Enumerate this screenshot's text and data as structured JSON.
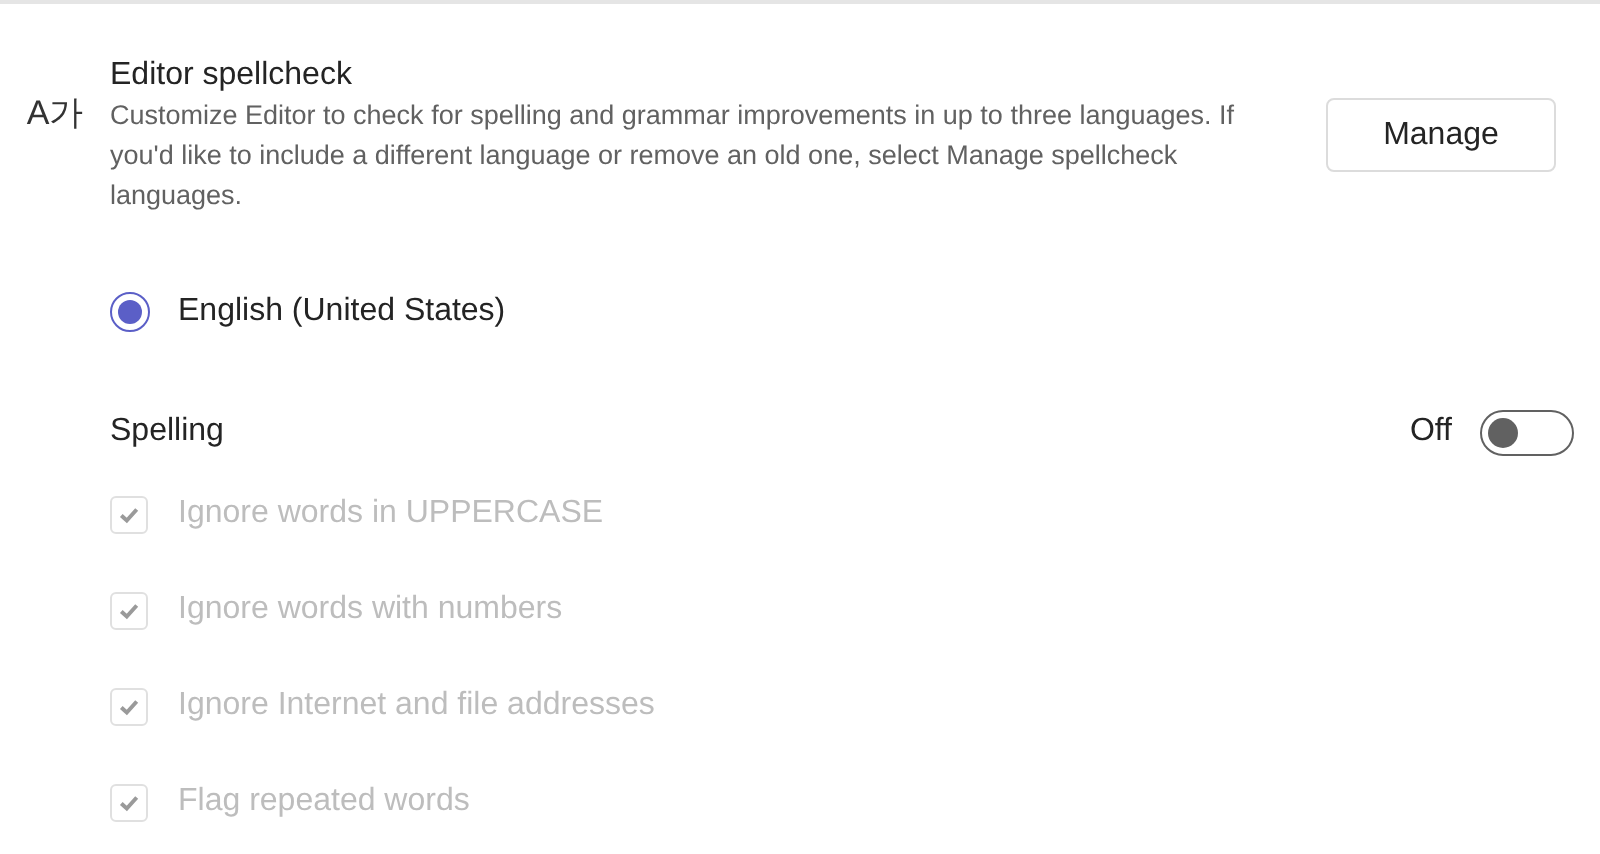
{
  "editor_spellcheck": {
    "icon": "A가",
    "title": "Editor spellcheck",
    "description": "Customize Editor to check for spelling and grammar improvements in up to three languages. If you'd like to include a different language or remove an old one, select Manage spellcheck languages.",
    "button": "Manage"
  },
  "languages": [
    {
      "label": "English (United States)",
      "selected": true
    }
  ],
  "spelling": {
    "title": "Spelling",
    "toggle_label": "Off",
    "on": false,
    "options": [
      {
        "label": "Ignore words in UPPERCASE",
        "checked": true,
        "disabled": true
      },
      {
        "label": "Ignore words with numbers",
        "checked": true,
        "disabled": true
      },
      {
        "label": "Ignore Internet and file addresses",
        "checked": true,
        "disabled": true
      },
      {
        "label": "Flag repeated words",
        "checked": true,
        "disabled": true
      }
    ]
  }
}
